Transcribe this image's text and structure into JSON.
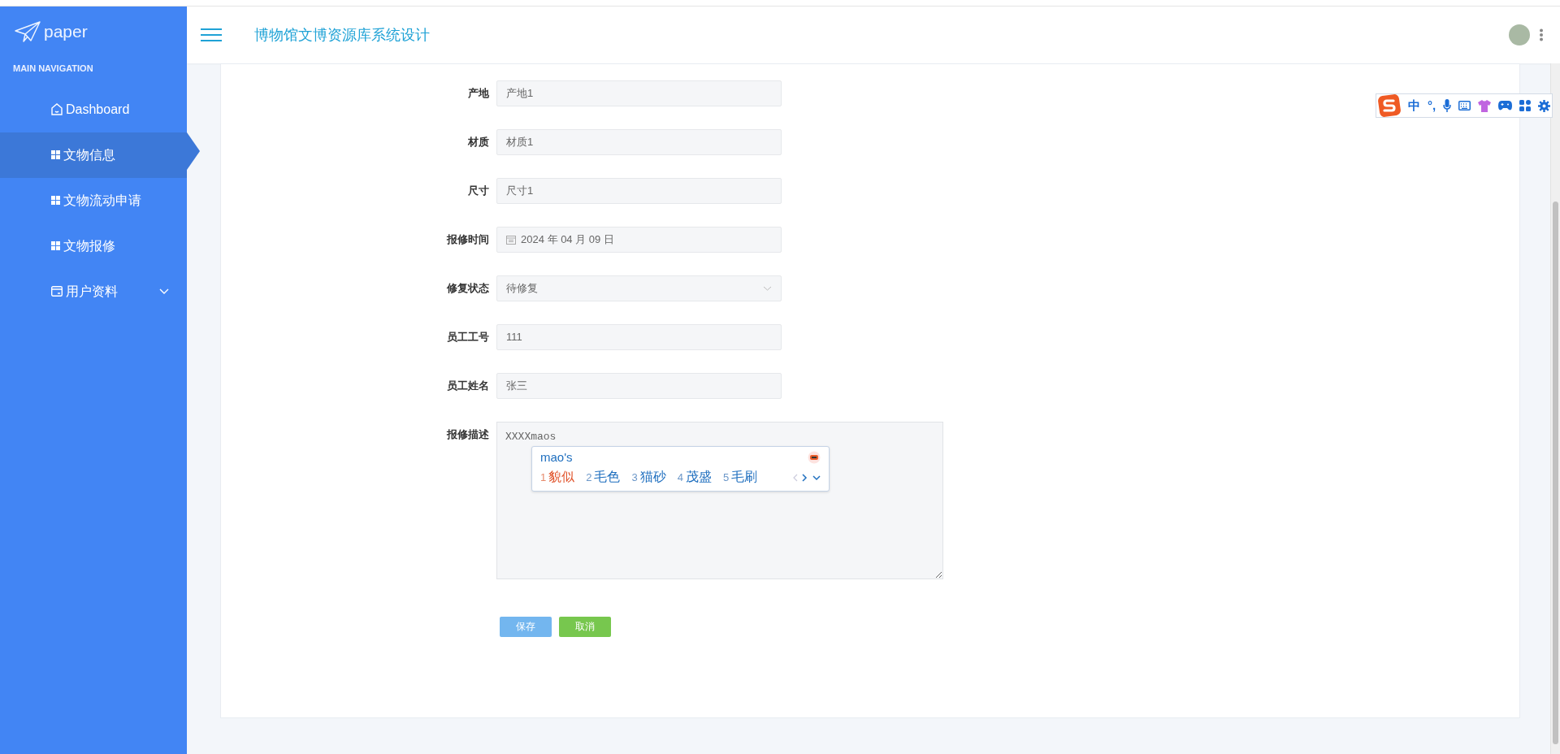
{
  "brand": {
    "logo_text": "paper"
  },
  "sidebar": {
    "heading": "MAIN NAVIGATION",
    "items": [
      {
        "label": "Dashboard",
        "kind": "home",
        "selected": false
      },
      {
        "label": "文物信息",
        "kind": "module",
        "selected": true
      },
      {
        "label": "文物流动申请",
        "kind": "module",
        "selected": false
      },
      {
        "label": "文物报修",
        "kind": "module",
        "selected": false
      },
      {
        "label": "用户资料",
        "kind": "submenu",
        "selected": false
      }
    ]
  },
  "header": {
    "title": "博物馆文博资源库系统设计"
  },
  "form": {
    "fields": [
      {
        "label": "产地",
        "kind": "text",
        "value": "产地1"
      },
      {
        "label": "材质",
        "kind": "text",
        "value": "材质1"
      },
      {
        "label": "尺寸",
        "kind": "text",
        "value": "尺寸1"
      },
      {
        "label": "报修时间",
        "kind": "date",
        "value": "2024 年 04 月 09 日"
      },
      {
        "label": "修复状态",
        "kind": "select",
        "value": "待修复"
      },
      {
        "label": "员工工号",
        "kind": "text",
        "value": "111"
      },
      {
        "label": "员工姓名",
        "kind": "text",
        "value": "张三"
      },
      {
        "label": "报修描述",
        "kind": "textarea",
        "value": "XXXXmaos"
      }
    ],
    "buttons": [
      {
        "label": "保存",
        "kind": "primary"
      },
      {
        "label": "取消",
        "kind": "success"
      }
    ]
  },
  "ime_popup": {
    "composition": "mao's",
    "candidates": [
      {
        "index": "1",
        "text": "貌似",
        "selected": true
      },
      {
        "index": "2",
        "text": "毛色",
        "selected": false
      },
      {
        "index": "3",
        "text": "猫砂",
        "selected": false
      },
      {
        "index": "4",
        "text": "茂盛",
        "selected": false
      },
      {
        "index": "5",
        "text": "毛刷",
        "selected": false
      }
    ]
  },
  "ime_toolbar": {
    "mode": "中",
    "punctuation": "°,"
  }
}
